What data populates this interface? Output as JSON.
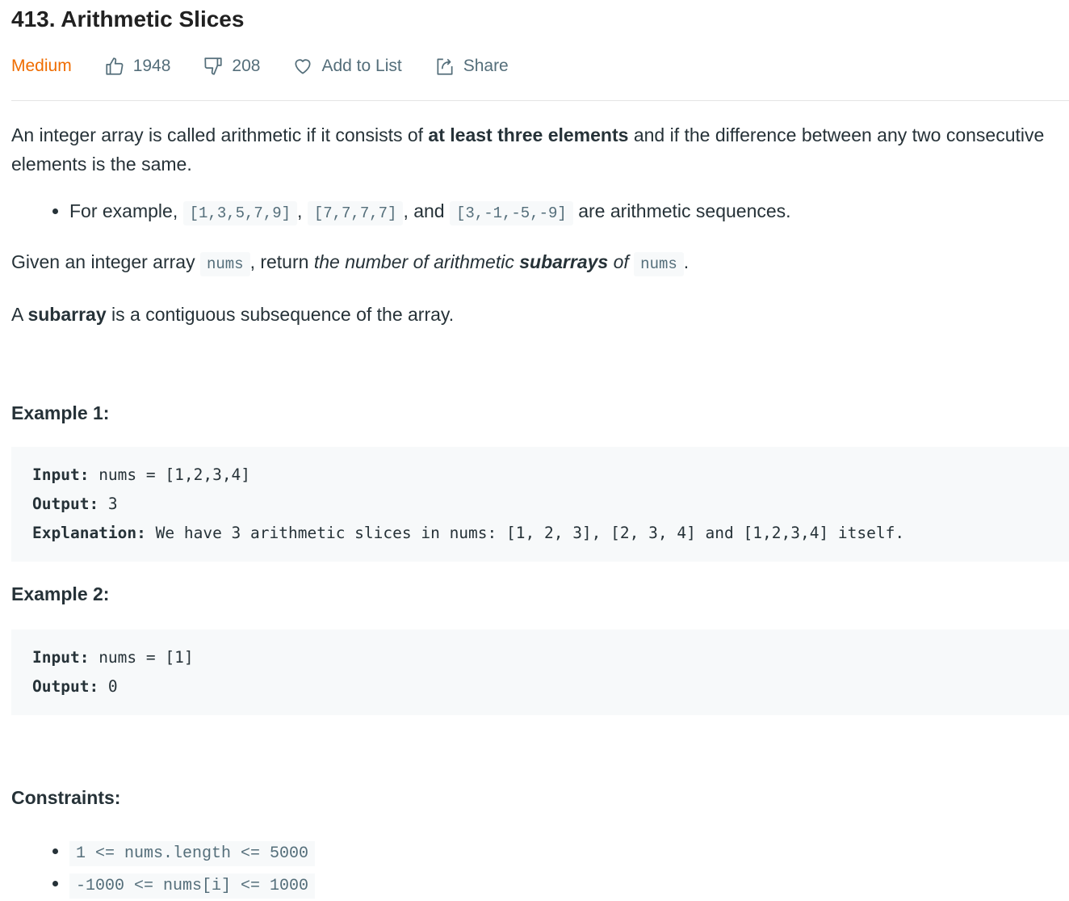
{
  "title": "413. Arithmetic Slices",
  "meta": {
    "difficulty": "Medium",
    "difficulty_color": "#ef6c00",
    "likes": "1948",
    "dislikes": "208",
    "add_to_list": "Add to List",
    "share": "Share",
    "icons": [
      "thumbs-up-icon",
      "thumbs-down-icon",
      "heart-icon",
      "share-icon"
    ]
  },
  "description": {
    "p1_a": "An integer array is called arithmetic if it consists of ",
    "p1_b": "at least three elements",
    "p1_c": " and if the difference between any two consecutive elements is the same.",
    "bullet_a": "For example, ",
    "bullet_code1": "[1,3,5,7,9]",
    "bullet_b": ", ",
    "bullet_code2": "[7,7,7,7]",
    "bullet_c": ", and ",
    "bullet_code3": "[3,-1,-5,-9]",
    "bullet_d": " are arithmetic sequences.",
    "p2_a": "Given an integer array ",
    "p2_code1": "nums",
    "p2_b": ", return ",
    "p2_c": "the number of arithmetic ",
    "p2_d": "subarrays",
    "p2_e": " of ",
    "p2_code2": "nums",
    "p2_f": ".",
    "p3_a": "A ",
    "p3_b": "subarray",
    "p3_c": " is a contiguous subsequence of the array."
  },
  "examples": [
    {
      "heading": "Example 1:",
      "input_label": "Input:",
      "input": " nums = [1,2,3,4]",
      "output_label": "Output:",
      "output": " 3",
      "explanation_label": "Explanation:",
      "explanation": " We have 3 arithmetic slices in nums: [1, 2, 3], [2, 3, 4] and [1,2,3,4] itself."
    },
    {
      "heading": "Example 2:",
      "input_label": "Input:",
      "input": " nums = [1]",
      "output_label": "Output:",
      "output": " 0"
    }
  ],
  "constraints": {
    "heading": "Constraints:",
    "items": [
      "1 <= nums.length <= 5000",
      "-1000 <= nums[i] <= 1000"
    ]
  }
}
